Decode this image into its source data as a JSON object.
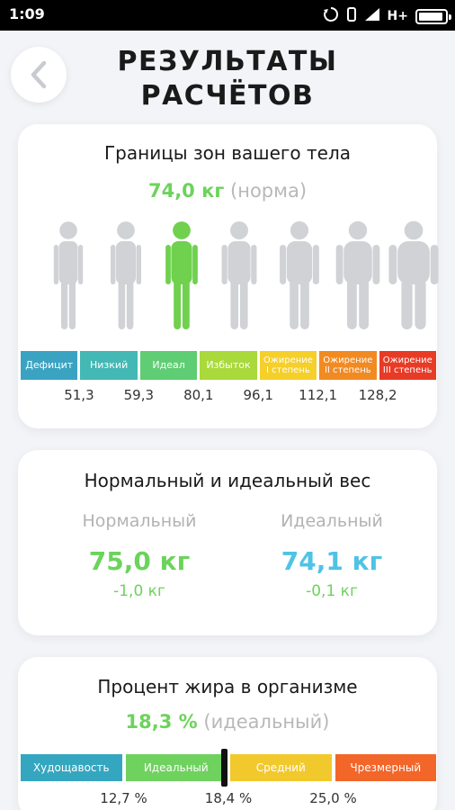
{
  "status_bar": {
    "time": "1:09",
    "network": "H+",
    "icons": [
      "sync-icon",
      "vibrate-icon",
      "signal-icon",
      "battery-icon"
    ]
  },
  "header": {
    "title_line1": "РЕЗУЛЬТАТЫ",
    "title_line2": "РАСЧЁТОВ",
    "back_icon": "chevron-left-icon"
  },
  "zones": {
    "title": "Границы зон вашего тела",
    "weight": "74,0 кг",
    "status": "(норма)",
    "figures": [
      {
        "label": "Дефицит",
        "highlight": false,
        "width": 1.0
      },
      {
        "label": "Низкий",
        "highlight": false,
        "width": 1.05
      },
      {
        "label": "Идеал",
        "highlight": true,
        "width": 1.1
      },
      {
        "label": "Избыток",
        "highlight": false,
        "width": 1.2
      },
      {
        "label": "Ожирение I",
        "highlight": false,
        "width": 1.35
      },
      {
        "label": "Ожирение II",
        "highlight": false,
        "width": 1.5
      },
      {
        "label": "Ожирение III",
        "highlight": false,
        "width": 1.7
      }
    ],
    "segments": [
      {
        "label": "Дефицит",
        "color": "#3aa3c2"
      },
      {
        "label": "Низкий",
        "color": "#43b8b4"
      },
      {
        "label": "Идеал",
        "color": "#5fcd73"
      },
      {
        "label": "Избыток",
        "color": "#a9d93b"
      },
      {
        "label": "Ожирение I степень",
        "color": "#f5cf2a"
      },
      {
        "label": "Ожирение II степень",
        "color": "#f28a22"
      },
      {
        "label": "Ожирение III степень",
        "color": "#e83b26"
      }
    ],
    "thresholds": [
      "51,3",
      "59,3",
      "80,1",
      "96,1",
      "112,1",
      "128,2"
    ]
  },
  "weight_section": {
    "title": "Нормальный и идеальный вес",
    "normal": {
      "label": "Нормальный",
      "value": "75,0 кг",
      "delta": "-1,0 кг",
      "color": "#6cd35b"
    },
    "ideal": {
      "label": "Идеальный",
      "value": "74,1 кг",
      "delta": "-0,1 кг",
      "color": "#4fc3e6"
    }
  },
  "fat": {
    "title": "Процент жира в организме",
    "value": "18,3 %",
    "status": "(идеальный)",
    "segments": [
      {
        "label": "Худощавость",
        "color": "#35a6c0"
      },
      {
        "label": "Идеальный",
        "color": "#6fd15e"
      },
      {
        "label": "Средний",
        "color": "#f2c92d"
      },
      {
        "label": "Чрезмерный",
        "color": "#f2662a"
      }
    ],
    "thresholds": [
      "12,7 %",
      "18,4 %",
      "25,0 %"
    ],
    "marker_fraction": 0.49
  }
}
